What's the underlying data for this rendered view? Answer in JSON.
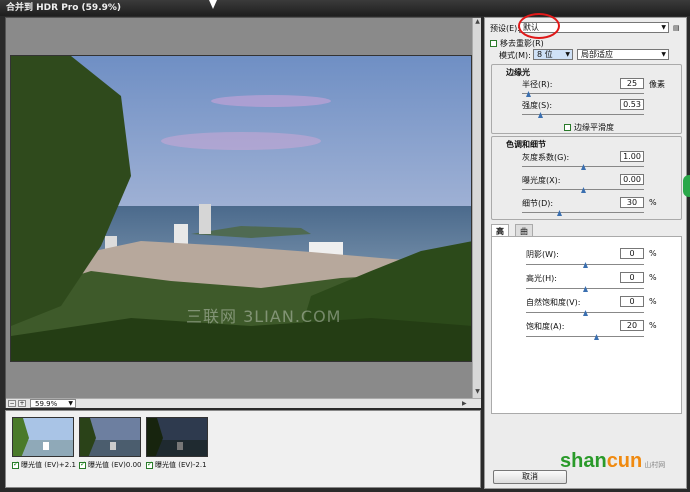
{
  "window": {
    "title": "合并到 HDR Pro (59.9%)"
  },
  "preview": {
    "zoom_value": "59.9%",
    "watermark": "三联网 3LIAN.COM"
  },
  "thumbnails": [
    {
      "label": "曝光值 (EV)+2.1",
      "checked": true
    },
    {
      "label": "曝光值 (EV)0.00",
      "checked": true
    },
    {
      "label": "曝光值 (EV)-2.1",
      "checked": true
    }
  ],
  "panel": {
    "preset_label": "预设(E):",
    "preset_value": "默认",
    "remove_ghost_label": "移去重影(R)",
    "mode_label": "模式(M):",
    "mode_value": "8 位",
    "method_value": "局部适应",
    "edge_glow": {
      "title": "边缘光",
      "radius_label": "半径(R):",
      "radius_value": "25",
      "radius_unit": "像素",
      "radius_level": 0.03,
      "strength_label": "强度(S):",
      "strength_value": "0.53",
      "strength_level": 0.14,
      "smooth_label": "边缘平滑度"
    },
    "tone_detail": {
      "title": "色调和细节",
      "gamma_label": "灰度系数(G):",
      "gamma_value": "1.00",
      "gamma_level": 0.5,
      "exposure_label": "曝光度(X):",
      "exposure_value": "0.00",
      "exposure_level": 0.5,
      "detail_label": "细节(D):",
      "detail_value": "30",
      "detail_unit": "%",
      "detail_level": 0.3
    },
    "tabs": [
      "高级",
      "曲线"
    ],
    "advanced": [
      {
        "label": "阴影(W):",
        "value": "0",
        "unit": "%",
        "level": 0.5
      },
      {
        "label": "高光(H):",
        "value": "0",
        "unit": "%",
        "level": 0.5
      },
      {
        "label": "自然饱和度(V):",
        "value": "0",
        "unit": "%",
        "level": 0.5
      },
      {
        "label": "饱和度(A):",
        "value": "20",
        "unit": "%",
        "level": 0.6
      }
    ],
    "cancel_label": "取消"
  },
  "logo": {
    "text_green": "shan",
    "text_orange": "cun",
    "small": "山村网"
  },
  "colors": {
    "annotation_circle": "#e01818",
    "slider_thumb": "#3a6fb0",
    "logo_green": "#2a9a2a",
    "logo_orange": "#f08a10"
  }
}
